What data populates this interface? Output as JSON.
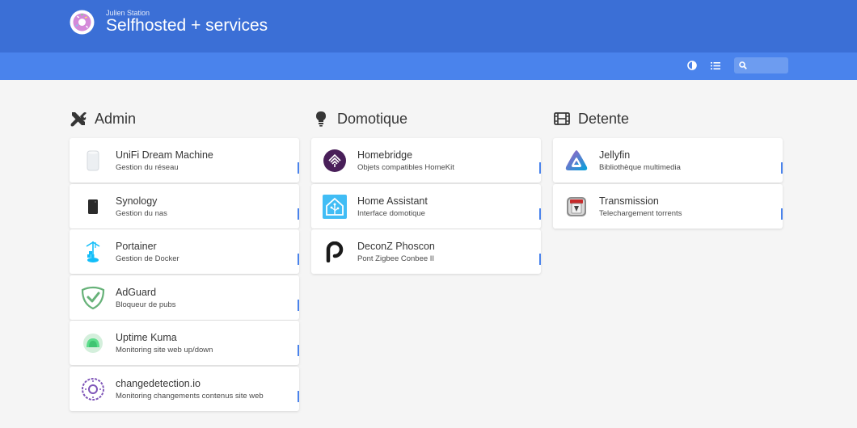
{
  "header": {
    "subtitle": "Julien Station",
    "title": "Selfhosted + services"
  },
  "navbar": {
    "search_placeholder": "",
    "theme_icon": "half-circle-icon",
    "layout_icon": "list-icon",
    "search_icon": "search-icon"
  },
  "colors": {
    "hero": "#3b6fd6",
    "navbar": "#4a83ec",
    "tag": "#4a83ec"
  },
  "groups": [
    {
      "name": "Admin",
      "icon": "tools-icon",
      "items": [
        {
          "name": "UniFi Dream Machine",
          "subtitle": "Gestion du réseau",
          "icon": "unifi-icon"
        },
        {
          "name": "Synology",
          "subtitle": "Gestion du nas",
          "icon": "synology-icon"
        },
        {
          "name": "Portainer",
          "subtitle": "Gestion de Docker",
          "icon": "portainer-icon"
        },
        {
          "name": "AdGuard",
          "subtitle": "Bloqueur de pubs",
          "icon": "adguard-icon"
        },
        {
          "name": "Uptime Kuma",
          "subtitle": "Monitoring site web up/down",
          "icon": "uptime-kuma-icon"
        },
        {
          "name": "changedetection.io",
          "subtitle": "Monitoring changements contenus site web",
          "icon": "changedetection-icon"
        }
      ]
    },
    {
      "name": "Domotique",
      "icon": "lightbulb-icon",
      "items": [
        {
          "name": "Homebridge",
          "subtitle": "Objets compatibles HomeKit",
          "icon": "homebridge-icon"
        },
        {
          "name": "Home Assistant",
          "subtitle": "Interface domotique",
          "icon": "home-assistant-icon"
        },
        {
          "name": "DeconZ Phoscon",
          "subtitle": "Pont Zigbee Conbee II",
          "icon": "phoscon-icon"
        }
      ]
    },
    {
      "name": "Detente",
      "icon": "film-icon",
      "items": [
        {
          "name": "Jellyfin",
          "subtitle": "Bibliothèque multimedia",
          "icon": "jellyfin-icon"
        },
        {
          "name": "Transmission",
          "subtitle": "Telechargement torrents",
          "icon": "transmission-icon"
        }
      ]
    }
  ]
}
